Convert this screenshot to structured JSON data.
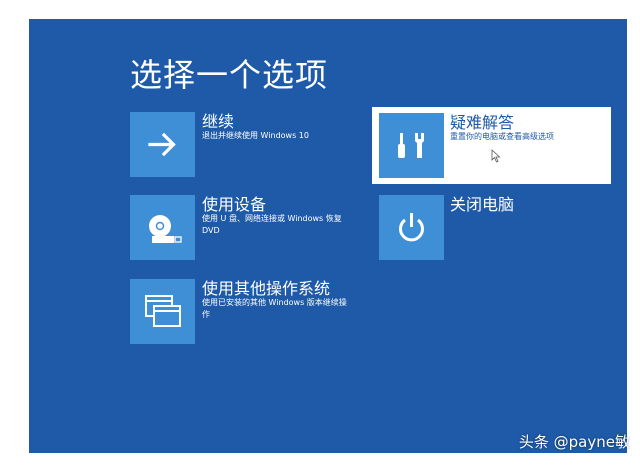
{
  "title": "选择一个选项",
  "options": [
    {
      "title": "继续",
      "description": "退出并继续使用 Windows 10",
      "icon": "arrow-right-icon"
    },
    {
      "title": "疑难解答",
      "description": "重置你的电脑或查看高级选项",
      "icon": "tools-icon"
    },
    {
      "title": "使用设备",
      "description": "使用 U 盘、网络连接或 Windows 恢复 DVD",
      "icon": "disc-drive-icon"
    },
    {
      "title": "关闭电脑",
      "description": "",
      "icon": "power-icon"
    },
    {
      "title": "使用其他操作系统",
      "description": "使用已安装的其他 Windows 版本继续操作",
      "icon": "windows-stack-icon"
    }
  ],
  "watermark": "头条 @payne敏",
  "colors": {
    "background": "#1e5aa8",
    "tile": "#3f8fd6",
    "selected_bg": "#ffffff",
    "text": "#ffffff"
  }
}
